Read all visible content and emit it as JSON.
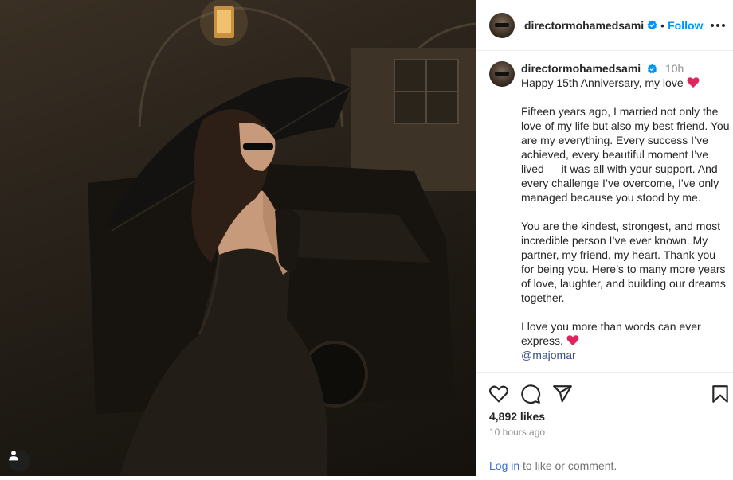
{
  "post": {
    "username": "directormohamedsami",
    "follow_label": "Follow",
    "separator": "•",
    "time_short": "10h",
    "caption_title": "Happy 15th Anniversary, my love",
    "paragraphs": [
      "Fifteen years ago, I married not only the love of my life but also my best friend. You are my everything. Every success I’ve achieved, every beautiful moment I’ve lived — it was all with your support. And every challenge I’ve overcome, I’ve only managed because you stood by me.",
      "You are the kindest, strongest, and most incredible person I’ve ever known. My partner, my friend, my heart. Thank you for being you. Here’s to many more years of love, laughter, and building our dreams together.",
      "I love you more than words can ever express."
    ],
    "mention": "@majomar",
    "likes": "4,892 likes",
    "time_ago": "10 hours ago",
    "login_link": "Log in",
    "login_rest": " to like or comment."
  },
  "icons": {
    "more": "more-options-icon",
    "like": "heart-icon",
    "comment": "comment-icon",
    "share": "share-icon",
    "save": "bookmark-icon",
    "verified": "verified-badge-icon",
    "tag": "user-tag-icon"
  },
  "colors": {
    "link_blue": "#0095f6",
    "verified_blue": "#0095f6",
    "heart_red": "#e0245e",
    "muted": "#8e8e8e"
  }
}
